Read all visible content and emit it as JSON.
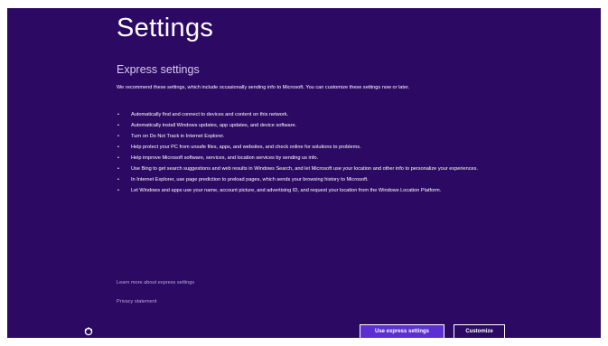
{
  "title": "Settings",
  "subtitle": "Express settings",
  "intro": "We recommend these settings, which include occasionally sending info to Microsoft. You can customize these settings now or later.",
  "bullets": [
    "Automatically find and connect to devices and content on this network.",
    "Automatically install Windows updates, app updates, and device software.",
    "Turn on Do Not Track in Internet Explorer.",
    "Help protect your PC from unsafe files, apps, and websites, and check online for solutions to problems.",
    "Help improve Microsoft software, services, and location services by sending us info.",
    "Use Bing to get search suggestions and web results in Windows Search, and let Microsoft use your location and other info to personalize your experiences.",
    "In Internet Explorer, use page prediction to preload pages, which sends your browsing history to Microsoft.",
    "Let Windows and apps use your name, account picture, and advertising ID, and request your location from the Windows Location Platform."
  ],
  "bullet_glyph": "•",
  "links": {
    "learn_more": "Learn more about express settings",
    "privacy": "Privacy statement"
  },
  "buttons": {
    "express": "Use express settings",
    "customize": "Customize"
  },
  "icons": {
    "ease_of_access": "ease-of-access-icon"
  },
  "colors": {
    "background": "#2c0a63",
    "primary_button": "#5b2fd0",
    "link": "#b9a3e0"
  }
}
